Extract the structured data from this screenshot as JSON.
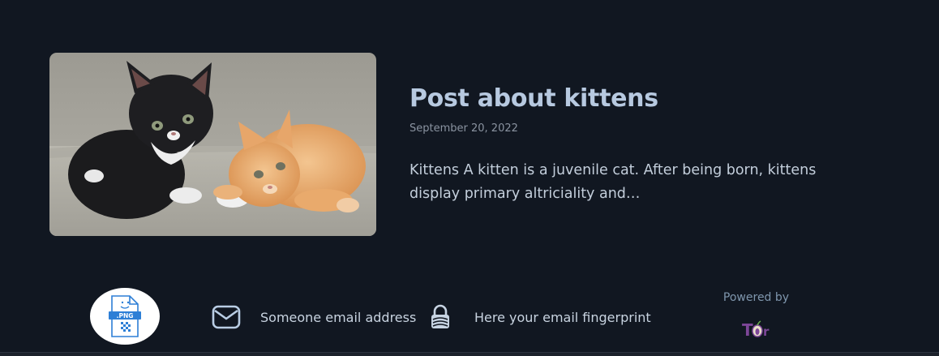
{
  "post": {
    "title": "Post about kittens",
    "date": "September 20, 2022",
    "excerpt": "Kittens A kitten is a juvenile cat. After being born, kittens display primary altriciality and…"
  },
  "footer": {
    "avatar_icon": "png-file-icon",
    "avatar_badge": ".PNG",
    "email_icon": "envelope-icon",
    "email_label": "Someone email address",
    "fingerprint_icon": "padlock-icon",
    "fingerprint_label": "Here your email fingerprint",
    "powered_label": "Powered by",
    "powered_logo": "Tor"
  },
  "colors": {
    "background": "#111721",
    "title": "#b7c9e0",
    "tor_purple": "#7d4698"
  }
}
